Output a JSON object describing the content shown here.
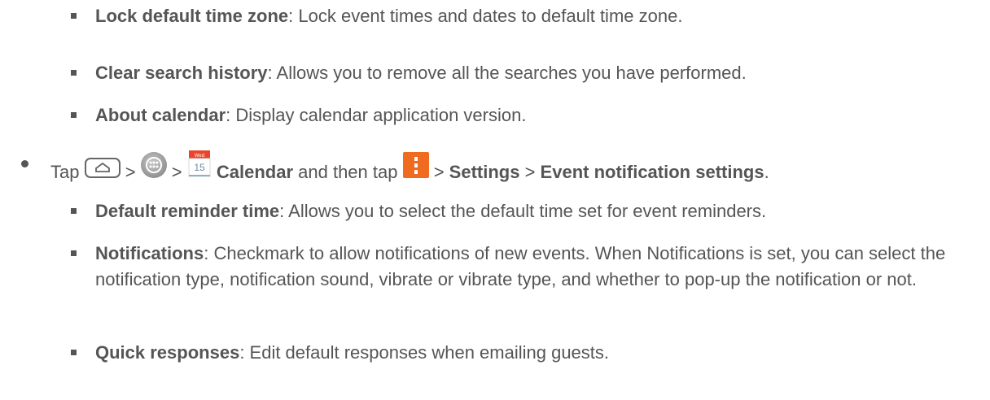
{
  "sub_items_top": [
    {
      "term": "Lock default time zone",
      "desc": ": Lock event times and dates to default time zone."
    },
    {
      "term": "Clear search history",
      "desc": ": Allows you to remove all the searches you have performed."
    },
    {
      "term": "About calendar",
      "desc": ": Display calendar application version."
    }
  ],
  "step": {
    "tap": "Tap",
    "sep1": " > ",
    "sep2": " > ",
    "calendar_icon_day": "Wed",
    "calendar_icon_date": "15",
    "calendar": " Calendar",
    "and_then_tap": " and then tap ",
    "sep3": " > ",
    "settings": "Settings",
    "sep4": " > ",
    "event_settings": "Event notification settings",
    "period": "."
  },
  "sub_items_bottom": [
    {
      "term": "Default reminder time",
      "desc": ": Allows you to select the default time set for event reminders."
    },
    {
      "term": "Notifications",
      "desc": ": Checkmark to allow notifications of new events. When Notifications is set, you can select the notification type, notification sound, vibrate or vibrate type, and whether to pop-up the notification or not."
    },
    {
      "term": "Quick responses",
      "desc": ": Edit default responses when emailing guests."
    }
  ],
  "icons": {
    "home_key": "home-key-icon",
    "apps": "apps-icon",
    "calendar": "calendar-icon",
    "menu": "menu-icon"
  },
  "colors": {
    "text": "#555555",
    "menu_orange": "#f06a1f",
    "calendar_red": "#e8452c"
  }
}
